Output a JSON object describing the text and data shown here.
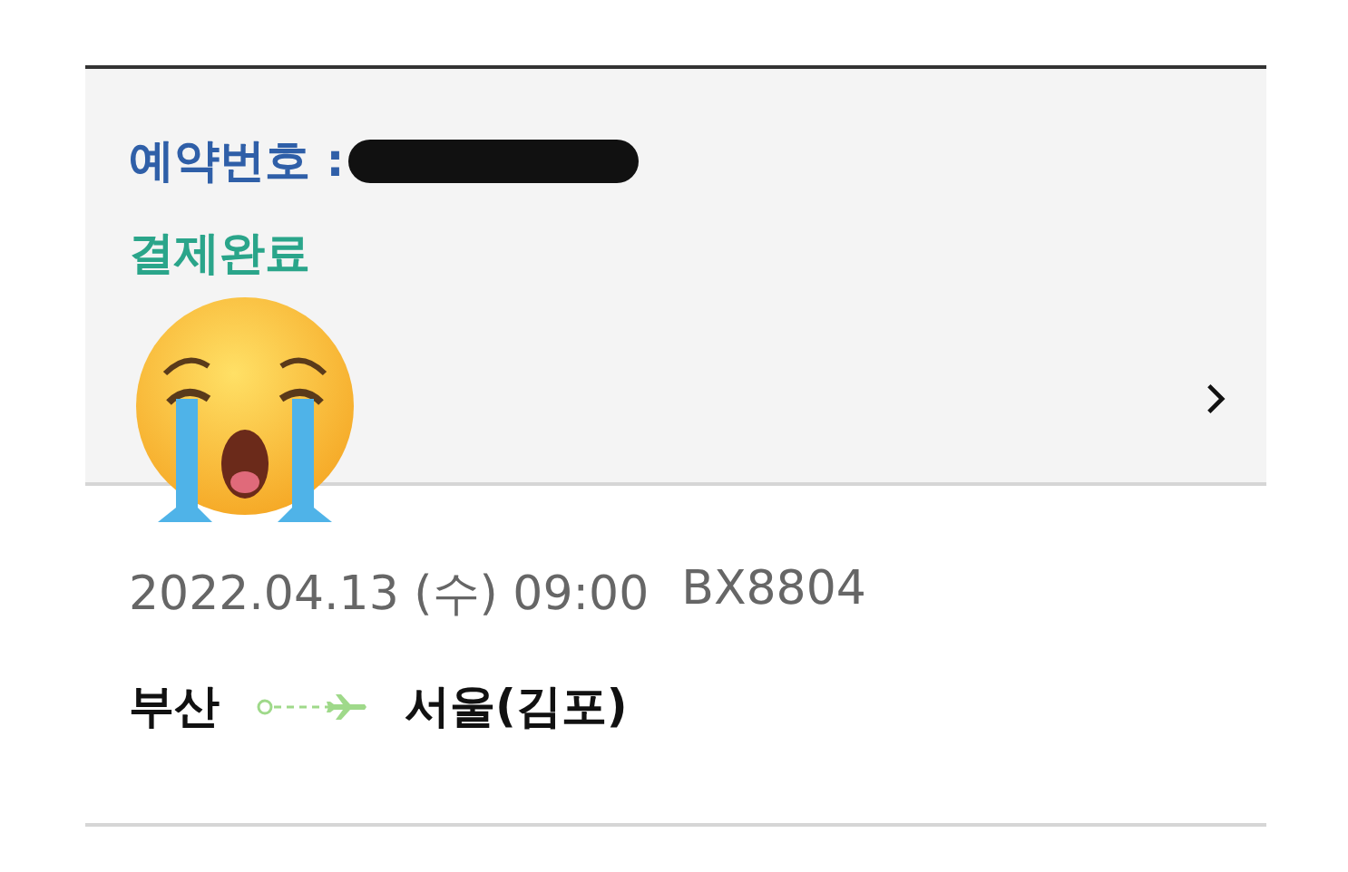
{
  "booking": {
    "number_label": "예약번호 :",
    "status": "결제완료"
  },
  "flight": {
    "date": "2022.04.13 (수) 09:00",
    "flight_no": "BX8804",
    "origin": "부산",
    "destination": "서울(김포)"
  }
}
